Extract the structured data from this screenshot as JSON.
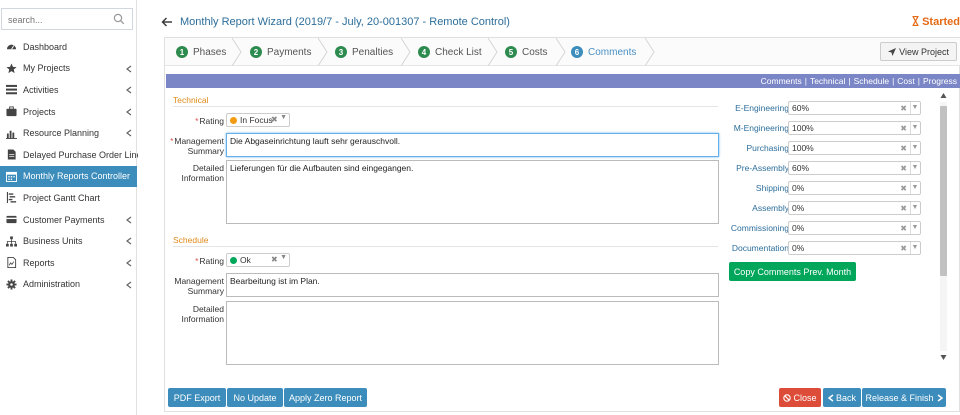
{
  "sidebar": {
    "search_placeholder": "search...",
    "items": [
      {
        "label": "Dashboard",
        "icon": "dashboard-icon",
        "has_chevron": false
      },
      {
        "label": "My Projects",
        "icon": "star-icon",
        "has_chevron": true
      },
      {
        "label": "Activities",
        "icon": "list-icon",
        "has_chevron": true
      },
      {
        "label": "Projects",
        "icon": "briefcase-icon",
        "has_chevron": true
      },
      {
        "label": "Resource Planning",
        "icon": "bar-chart-icon",
        "has_chevron": true
      },
      {
        "label": "Delayed Purchase Order Lines",
        "icon": "file-icon",
        "has_chevron": false
      },
      {
        "label": "Monthly Reports Controller",
        "icon": "calendar-icon",
        "has_chevron": false,
        "active": true
      },
      {
        "label": "Project Gantt Chart",
        "icon": "gantt-icon",
        "has_chevron": false
      },
      {
        "label": "Customer Payments",
        "icon": "credit-card-icon",
        "has_chevron": true
      },
      {
        "label": "Business Units",
        "icon": "sitemap-icon",
        "has_chevron": true
      },
      {
        "label": "Reports",
        "icon": "report-file-icon",
        "has_chevron": true
      },
      {
        "label": "Administration",
        "icon": "gear-icon",
        "has_chevron": true
      }
    ]
  },
  "header": {
    "title": "Monthly Report Wizard (2019/7 - July, 20-001307 - Remote Control)",
    "status": "Started"
  },
  "tabs": [
    {
      "num": "1",
      "label": "Phases"
    },
    {
      "num": "2",
      "label": "Payments"
    },
    {
      "num": "3",
      "label": "Penalties"
    },
    {
      "num": "4",
      "label": "Check List"
    },
    {
      "num": "5",
      "label": "Costs"
    },
    {
      "num": "6",
      "label": "Comments",
      "active": true
    }
  ],
  "view_project_label": "View Project",
  "section_nav": [
    "Comments",
    "Technical",
    "Schedule",
    "Cost",
    "Progress"
  ],
  "technical": {
    "title": "Technical",
    "rating_label": "Rating",
    "rating_value": "In Focus",
    "rating_color": "#f39c12",
    "management_label_1": "Management",
    "management_label_2": "Summary",
    "management_value": "Die Abgaseinrichtung lauft sehr gerauschvoll.",
    "detailed_label_1": "Detailed",
    "detailed_label_2": "Information",
    "detailed_value": "Lieferungen für die Aufbauten sind eingegangen."
  },
  "schedule": {
    "title": "Schedule",
    "rating_label": "Rating",
    "rating_value": "Ok",
    "rating_color": "#00a65a",
    "management_label_1": "Management",
    "management_label_2": "Summary",
    "management_value": "Bearbeitung ist im Plan.",
    "detailed_label_1": "Detailed",
    "detailed_label_2": "Information",
    "detailed_value": ""
  },
  "progress_fields": [
    {
      "label": "E-Engineering",
      "value": "60%"
    },
    {
      "label": "M-Engineering",
      "value": "100%"
    },
    {
      "label": "Purchasing",
      "value": "100%"
    },
    {
      "label": "Pre-Assembly",
      "value": "60%"
    },
    {
      "label": "Shipping",
      "value": "0%"
    },
    {
      "label": "Assembly",
      "value": "0%"
    },
    {
      "label": "Commissioning",
      "value": "0%"
    },
    {
      "label": "Documentation",
      "value": "0%"
    }
  ],
  "copy_comments_label": "Copy Comments Prev. Month",
  "footer": {
    "pdf_export": "PDF Export",
    "no_update": "No Update",
    "apply_zero": "Apply Zero Report",
    "close": "Close",
    "back": "Back",
    "release_finish": "Release & Finish"
  },
  "colors": {
    "accent": "#3c8dbc",
    "success": "#00a65a",
    "danger": "#dd4b39",
    "section_bar": "#7b86c6",
    "status": "#e46a16"
  }
}
